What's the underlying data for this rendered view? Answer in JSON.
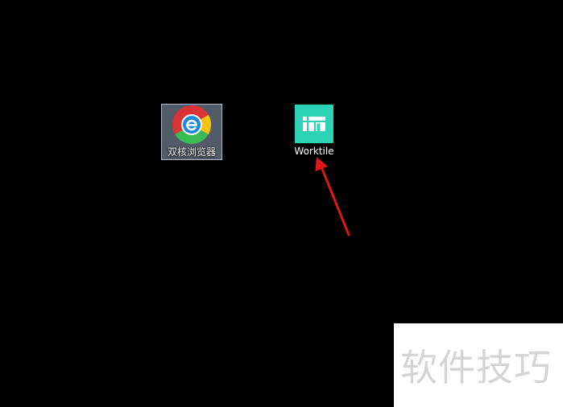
{
  "desktop": {
    "background_color": "#000000",
    "icons": [
      {
        "label": "双核浏览器",
        "icon": "chrome-e-browser-icon",
        "selected": true
      },
      {
        "label": "Worktile",
        "icon": "worktile-icon",
        "brand_color": "#2cd2b4",
        "selected": false
      }
    ],
    "annotation": {
      "type": "arrow",
      "color": "#e01818"
    }
  },
  "watermark": {
    "text": "软件技巧"
  }
}
